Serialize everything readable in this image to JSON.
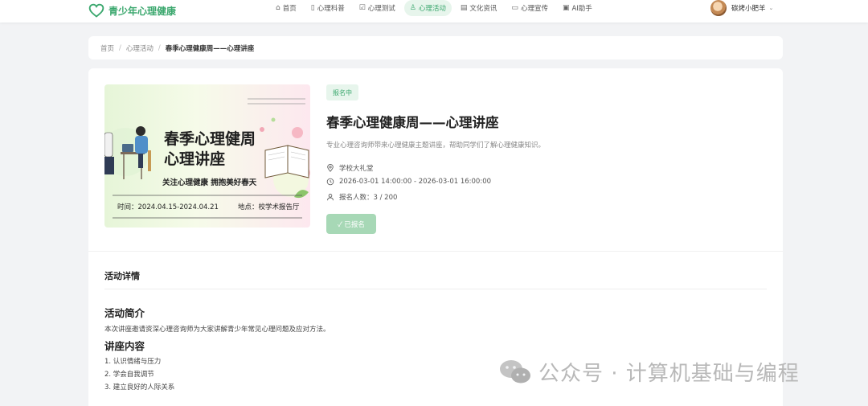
{
  "brand": {
    "name": "青少年心理健康"
  },
  "nav": [
    {
      "label": "首页",
      "icon": "home-icon"
    },
    {
      "label": "心理科普",
      "icon": "book-icon"
    },
    {
      "label": "心理测试",
      "icon": "checkbox-icon"
    },
    {
      "label": "心理活动",
      "icon": "users-icon",
      "active": true
    },
    {
      "label": "文化资讯",
      "icon": "news-icon"
    },
    {
      "label": "心理宣传",
      "icon": "chat-icon"
    },
    {
      "label": "AI助手",
      "icon": "robot-icon"
    }
  ],
  "user": {
    "name": "碳烤小肥羊"
  },
  "breadcrumb": {
    "home": "首页",
    "section": "心理活动",
    "current": "春季心理健康周——心理讲座",
    "separator": "/"
  },
  "event": {
    "status": "报名中",
    "title": "春季心理健康周——心理讲座",
    "description": "专业心理咨询师带来心理健康主题讲座，帮助同学们了解心理健康知识。",
    "location": "学校大礼堂",
    "time": "2026-03-01 14:00:00 - 2026-03-01 16:00:00",
    "signup": "报名人数：3 / 200",
    "button": "✓ 已报名",
    "poster": {
      "title": "春季心理健周心理讲座",
      "slogan": "关注心理健康 拥抱美好春天",
      "time": "时间：2024.04.15-2024.04.21",
      "place": "地点：校学术报告厅"
    }
  },
  "detail": {
    "heading": "活动详情",
    "intro_title": "活动简介",
    "intro_text": "本次讲座邀请资深心理咨询师为大家讲解青少年常见心理问题及应对方法。",
    "content_title": "讲座内容",
    "items": [
      "1. 认识情绪与压力",
      "2. 学会自我调节",
      "3. 建立良好的人际关系"
    ]
  },
  "watermark": {
    "text": "公众号 · 计算机基础与编程"
  },
  "colors": {
    "accent": "#3aa76d",
    "accent_light": "#e7f5ec",
    "button_disabled": "#a7d8b6"
  }
}
